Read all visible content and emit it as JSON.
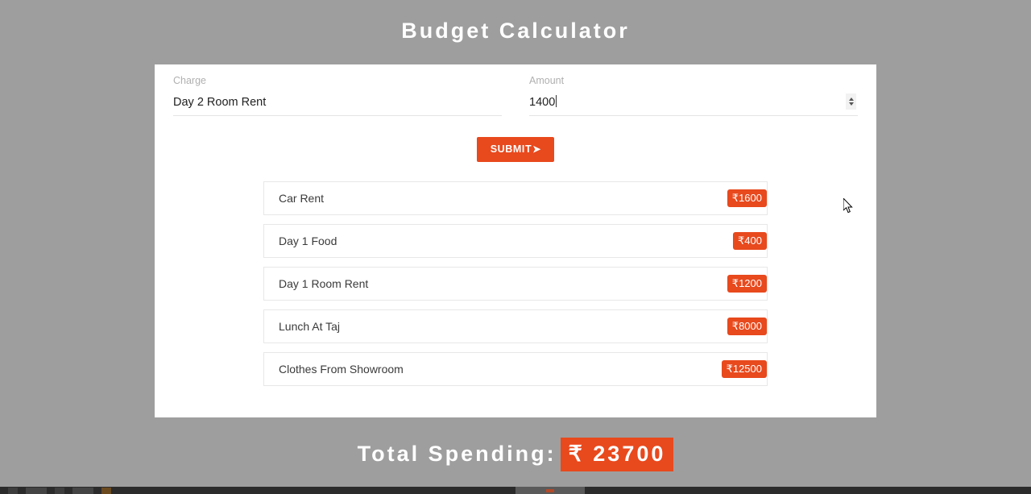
{
  "page": {
    "title": "Budget Calculator",
    "background_color": "#9e9e9e",
    "accent_color": "#e8491d"
  },
  "form": {
    "charge": {
      "label": "Charge",
      "value": "Day 2 Room Rent",
      "placeholder": ""
    },
    "amount": {
      "label": "Amount",
      "value": "1400",
      "placeholder": "",
      "spinner_up_icon": "chevron-up-icon",
      "spinner_down_icon": "chevron-down-icon"
    },
    "submit": {
      "label": "SUBMIT",
      "arrow_icon": "➤"
    }
  },
  "expenses": [
    {
      "name": "Car Rent",
      "amount": "₹1600"
    },
    {
      "name": "Day 1 Food",
      "amount": "₹400"
    },
    {
      "name": "Day 1 Room Rent",
      "amount": "₹1200"
    },
    {
      "name": "Lunch At Taj",
      "amount": "₹8000"
    },
    {
      "name": "Clothes From Showroom",
      "amount": "₹12500"
    }
  ],
  "total": {
    "label": "Total Spending:",
    "amount": "₹ 23700"
  }
}
